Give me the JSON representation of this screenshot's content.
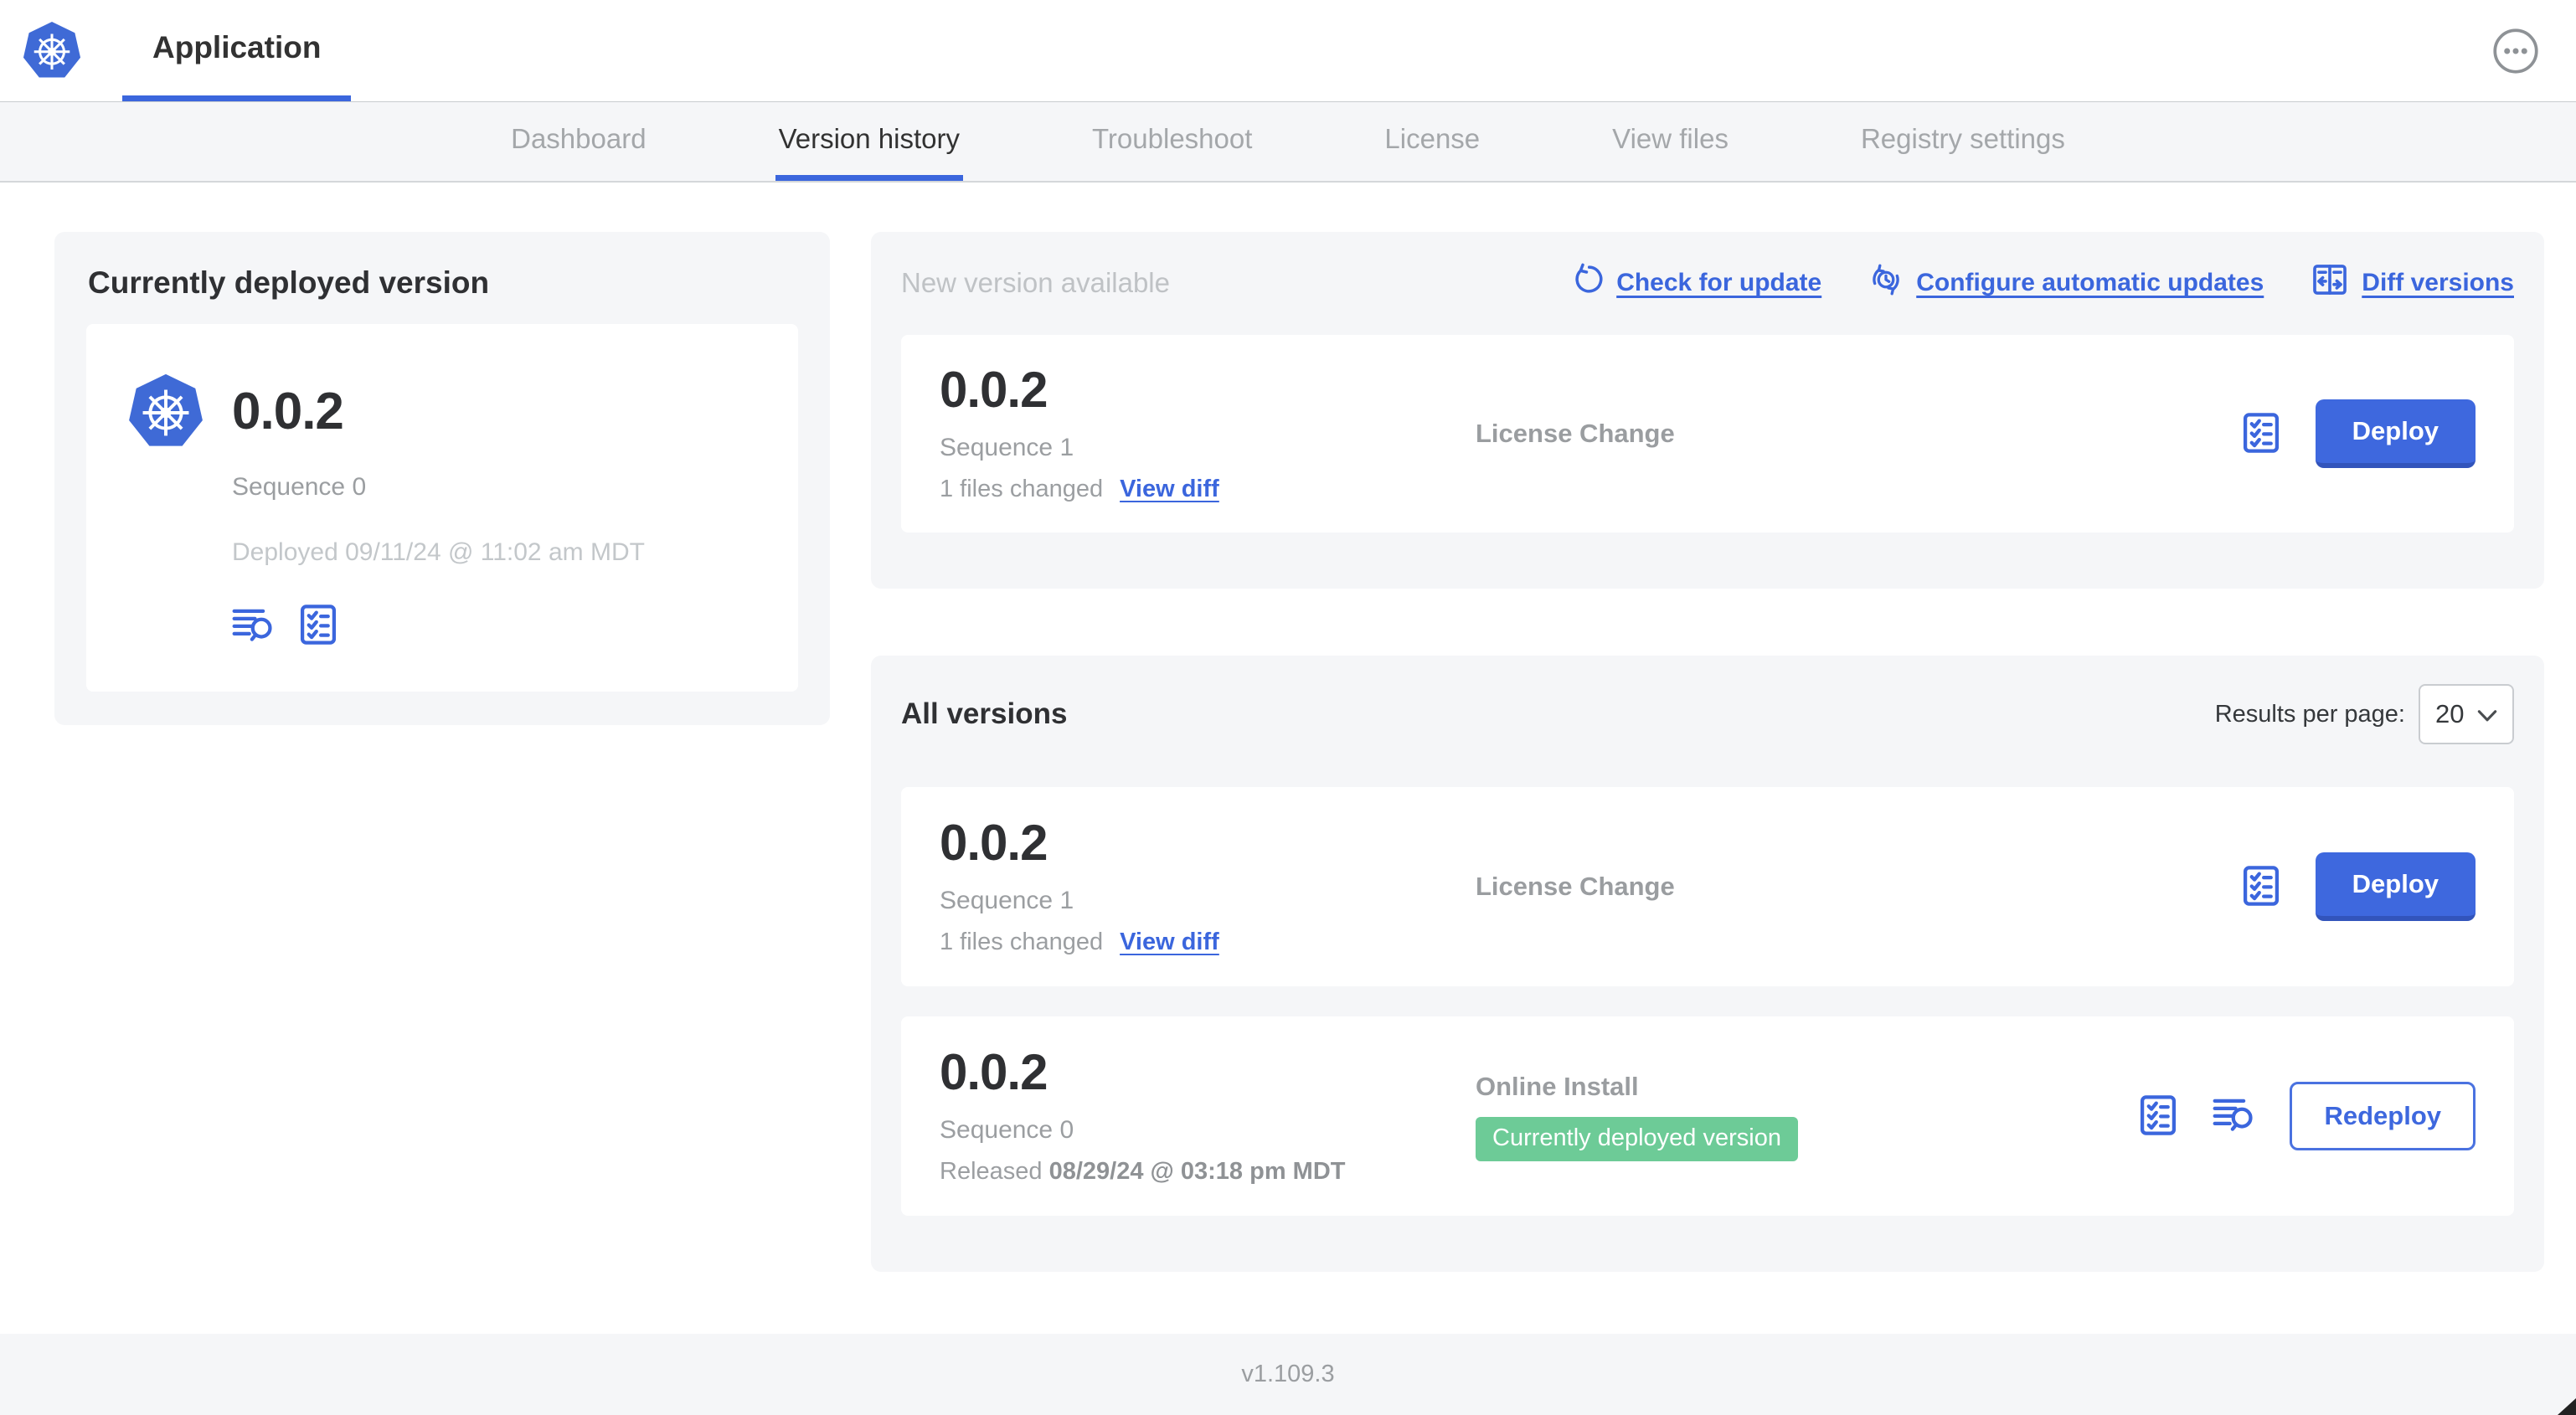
{
  "colors": {
    "accent_blue": "#3b66dd",
    "accent_blue_dark": "#3254bb",
    "badge_green": "#6dcb97",
    "panel_bg": "#f5f6f8",
    "text_dark": "#323232",
    "text_gray": "#9b9ea1",
    "text_light_gray": "#c3c7ca"
  },
  "header": {
    "title": "Application",
    "logo_icon": "kubernetes-logo",
    "menu_icon": "ellipsis-icon"
  },
  "nav": {
    "tabs": [
      {
        "label": "Dashboard",
        "active": false
      },
      {
        "label": "Version history",
        "active": true
      },
      {
        "label": "Troubleshoot",
        "active": false
      },
      {
        "label": "License",
        "active": false
      },
      {
        "label": "View files",
        "active": false
      },
      {
        "label": "Registry settings",
        "active": false
      }
    ]
  },
  "current": {
    "title": "Currently deployed version",
    "version": "0.0.2",
    "sequence": "Sequence 0",
    "deployed": "Deployed 09/11/24 @ 11:02 am MDT",
    "icons": [
      "logs-icon",
      "checklist-icon"
    ]
  },
  "newver": {
    "title": "New version available",
    "actions": [
      {
        "label": "Check for update",
        "icon": "refresh-icon"
      },
      {
        "label": "Configure automatic updates",
        "icon": "schedule-update-icon"
      },
      {
        "label": "Diff versions",
        "icon": "diff-icon"
      }
    ],
    "card": {
      "version": "0.0.2",
      "sequence": "Sequence 1",
      "files_changed": "1 files changed",
      "view_diff_label": "View diff",
      "source": "License Change",
      "deploy_label": "Deploy"
    }
  },
  "allver": {
    "title": "All versions",
    "results_label": "Results per page:",
    "results_value": "20",
    "rows": [
      {
        "version": "0.0.2",
        "sequence": "Sequence 1",
        "files_changed": "1 files changed",
        "view_diff_label": "View diff",
        "source": "License Change",
        "action_label": "Deploy"
      },
      {
        "version": "0.0.2",
        "sequence": "Sequence 0",
        "released_prefix": "Released ",
        "released_date": "08/29/24 @ 03:18 pm MDT",
        "source": "Online Install",
        "badge": "Currently deployed version",
        "action_label": "Redeploy"
      }
    ]
  },
  "footer": {
    "version": "v1.109.3"
  }
}
